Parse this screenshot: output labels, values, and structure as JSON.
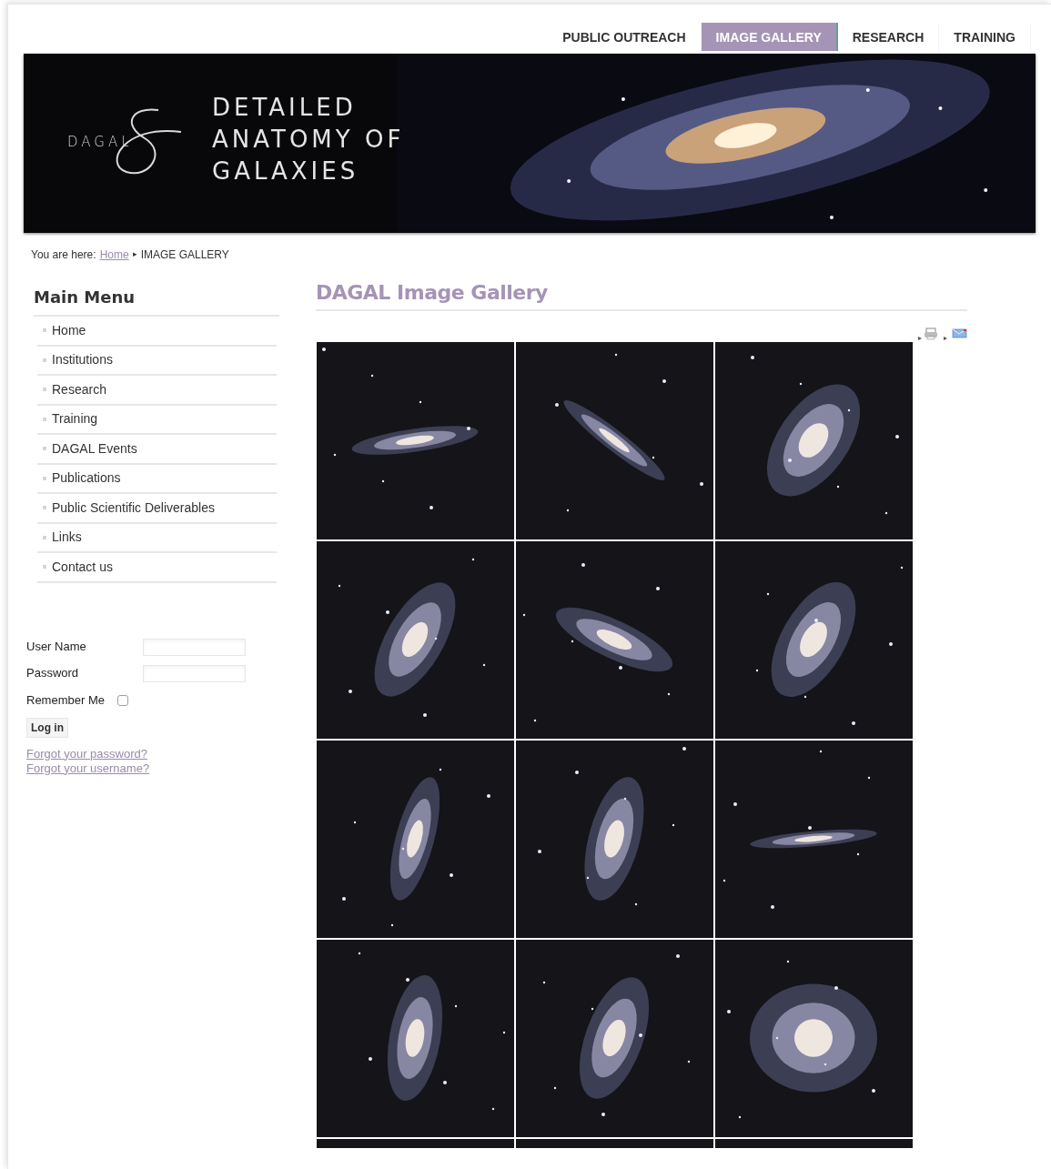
{
  "nav": [
    {
      "label": "PUBLIC OUTREACH",
      "selected": false
    },
    {
      "label": "IMAGE GALLERY",
      "selected": true
    },
    {
      "label": "RESEARCH",
      "selected": false
    },
    {
      "label": "TRAINING",
      "selected": false
    }
  ],
  "banner": {
    "logo": "DAGAL",
    "title_lines": [
      "DETAILED",
      "ANATOMY OF",
      "GALAXIES"
    ]
  },
  "breadcrumb": {
    "prefix": "You are here:",
    "link": "Home",
    "separator": "▸",
    "current": "IMAGE GALLERY"
  },
  "main_menu": {
    "title": "Main Menu",
    "items": [
      "Home",
      "Institutions",
      "Research",
      "Training",
      "DAGAL Events",
      "Publications",
      "Public Scientific Deliverables",
      "Links",
      "Contact us"
    ]
  },
  "login": {
    "username_label": "User Name",
    "password_label": "Password",
    "remember_label": "Remember Me",
    "remember_checked": false,
    "button": "Log in",
    "links": [
      "Forgot your password?",
      "Forgot your username?"
    ]
  },
  "gallery": {
    "title": "DAGAL Image Gallery"
  }
}
